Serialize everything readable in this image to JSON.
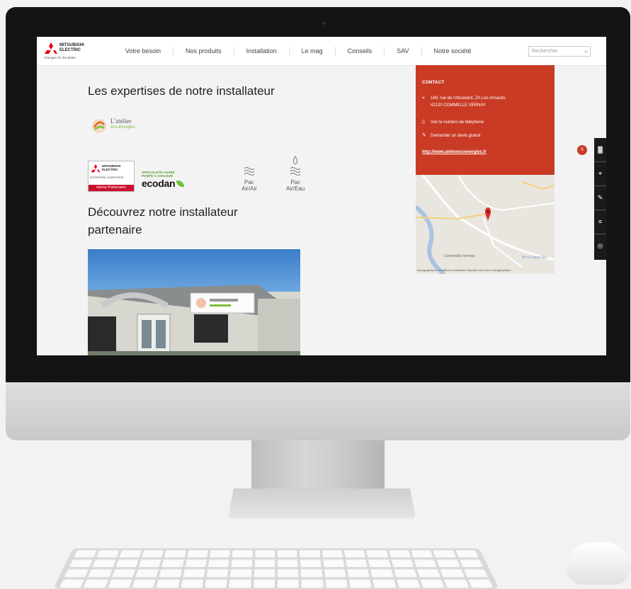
{
  "header": {
    "logo": {
      "line1": "MITSUBISHI",
      "line2": "ELECTRIC",
      "tagline": "Changes for the Better"
    },
    "nav": [
      "Votre besoin",
      "Nos produits",
      "Installation",
      "Le mag",
      "Conseils",
      "SAV",
      "Notre société"
    ],
    "search_placeholder": "Rechercher"
  },
  "main": {
    "expertise_title": "Les expertises de notre installateur",
    "latelier_logo": {
      "name": "L'atelier",
      "sub": "éco-énergies"
    },
    "mitsubishi_badge": {
      "sub": "ENTREPRISE COMPETENTE",
      "bar": "Home Partenaire"
    },
    "ecodan_badge": {
      "line1": "SPÉCIALISTE AGRÉÉ",
      "line2": "POMPE À CHALEUR",
      "word": "ecodan"
    },
    "pac_air_air": "Pac Air/Air",
    "pac_air_eau": "Pac Air/Eau",
    "partner_title": "Découvrez notre installateur partenaire"
  },
  "contact": {
    "title": "CONTACT",
    "address_line1": "169, rue de l'Atisanant, ZA Les Arnauds,",
    "address_line2": "42120 COMMELLE VERNAY",
    "phone": "Voir le numéro de téléphone",
    "quote": "Demander un devis gratuit",
    "url": "http://www.atelierecoenergies.fr"
  },
  "map": {
    "town": "Commelle-Vernay",
    "poi": "Brico Depot Ria",
    "caption": "cartographiques   Conditions d'utilisation   Signaler une erreur cartographique"
  },
  "toolbar": {
    "badge": "0"
  }
}
